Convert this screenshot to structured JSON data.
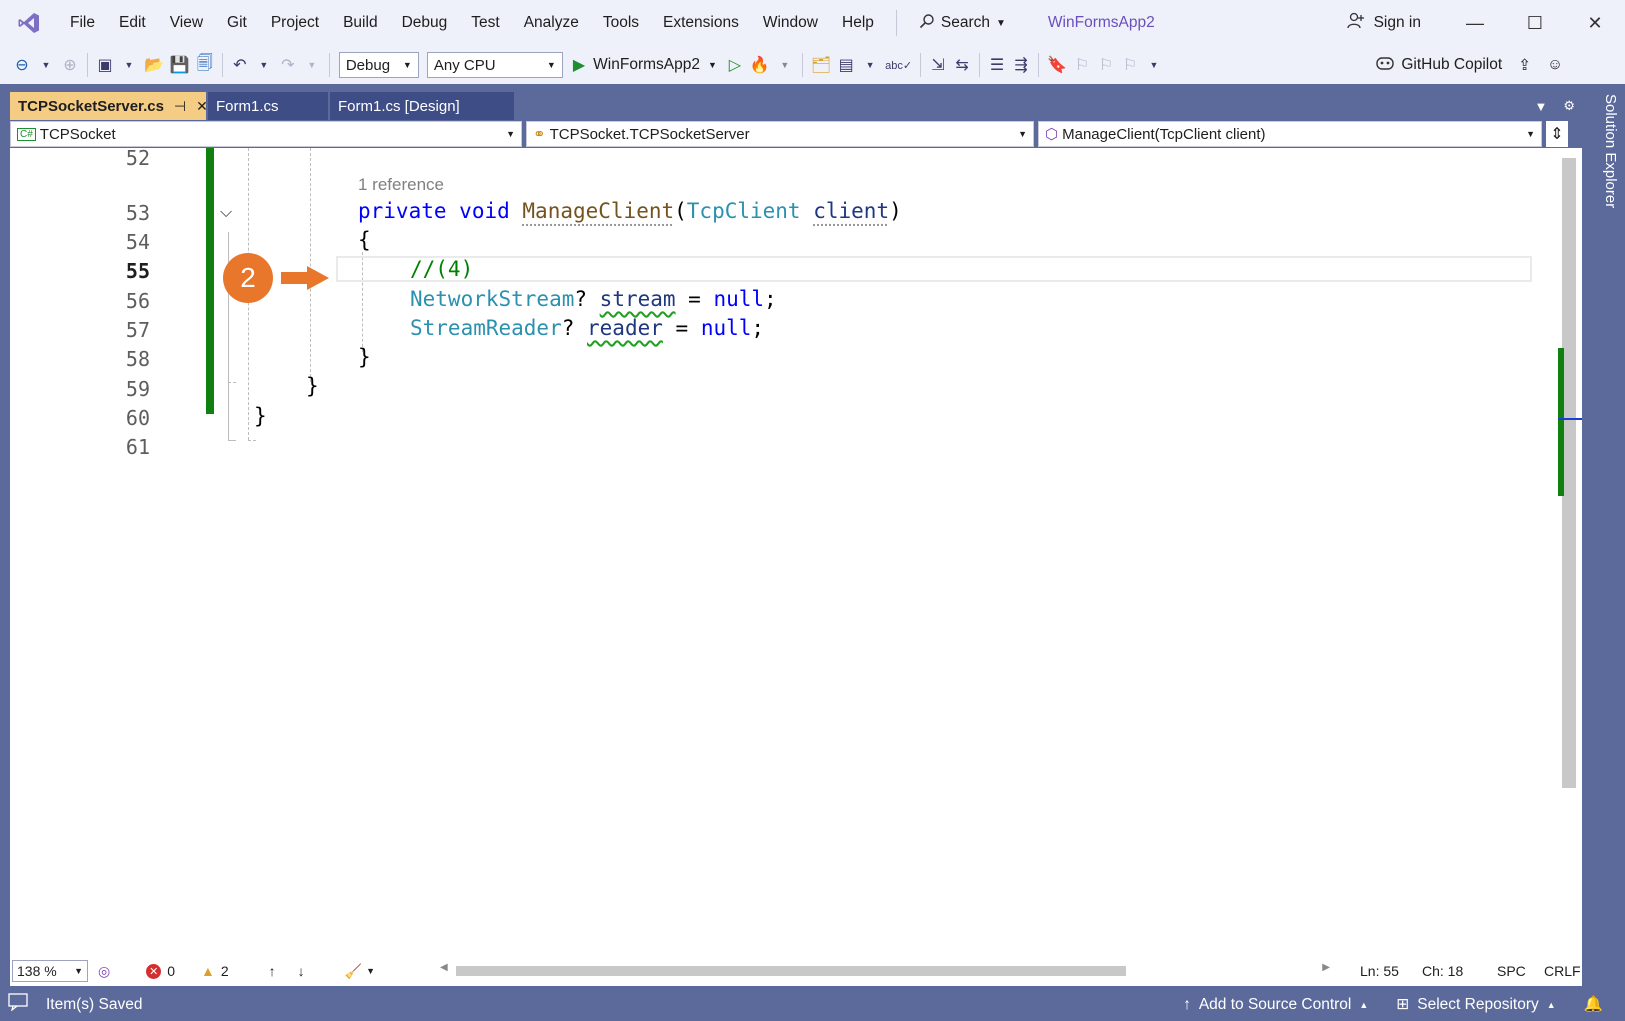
{
  "menubar": {
    "items": [
      "File",
      "Edit",
      "View",
      "Git",
      "Project",
      "Build",
      "Debug",
      "Test",
      "Analyze",
      "Tools",
      "Extensions",
      "Window",
      "Help"
    ],
    "search_label": "Search",
    "project_name": "WinFormsApp2",
    "signin_label": "Sign in"
  },
  "toolbar": {
    "configuration": "Debug",
    "platform": "Any CPU",
    "run_target": "WinFormsApp2",
    "copilot_label": "GitHub Copilot"
  },
  "tabs": [
    {
      "label": "TCPSocketServer.cs",
      "active": true
    },
    {
      "label": "Form1.cs",
      "active": false
    },
    {
      "label": "Form1.cs [Design]",
      "active": false
    }
  ],
  "solution_explorer_label": "Solution Explorer",
  "navbar": {
    "project": "TCPSocket",
    "type": "TCPSocket.TCPSocketServer",
    "member": "ManageClient(TcpClient client)"
  },
  "editor": {
    "line_numbers": [
      "52",
      "53",
      "54",
      "55",
      "56",
      "57",
      "58",
      "59",
      "60",
      "61"
    ],
    "current_line": "55",
    "reference_hint": "1 reference",
    "code": {
      "l53_kw1": "private",
      "l53_kw2": "void",
      "l53_method": "ManageClient",
      "l53_paren_open": "(",
      "l53_type": "TcpClient",
      "l53_param": "client",
      "l53_paren_close": ")",
      "l54": "{",
      "l55": "//(4)",
      "l56_type": "NetworkStream",
      "l56_rest1": "? ",
      "l56_var": "stream",
      "l56_rest2": " = ",
      "l56_null": "null",
      "l56_semi": ";",
      "l57_type": "StreamReader",
      "l57_rest1": "? ",
      "l57_var": "reader",
      "l57_rest2": " = ",
      "l57_null": "null",
      "l57_semi": ";",
      "l58": "}",
      "l59": "}",
      "l60": "}"
    },
    "annotation_number": "2"
  },
  "editor_status": {
    "zoom": "138 %",
    "errors": "0",
    "warnings": "2",
    "ln": "Ln: 55",
    "ch": "Ch: 18",
    "whitespace": "SPC",
    "line_ending": "CRLF"
  },
  "statusbar": {
    "message": "Item(s) Saved",
    "source_control": "Add to Source Control",
    "repository": "Select Repository"
  },
  "colors": {
    "accent_purple": "#6b4fbb",
    "frame": "#5b6a9b",
    "active_tab": "#f5cc84",
    "change_bar": "#108010",
    "badge": "#e8762b"
  }
}
